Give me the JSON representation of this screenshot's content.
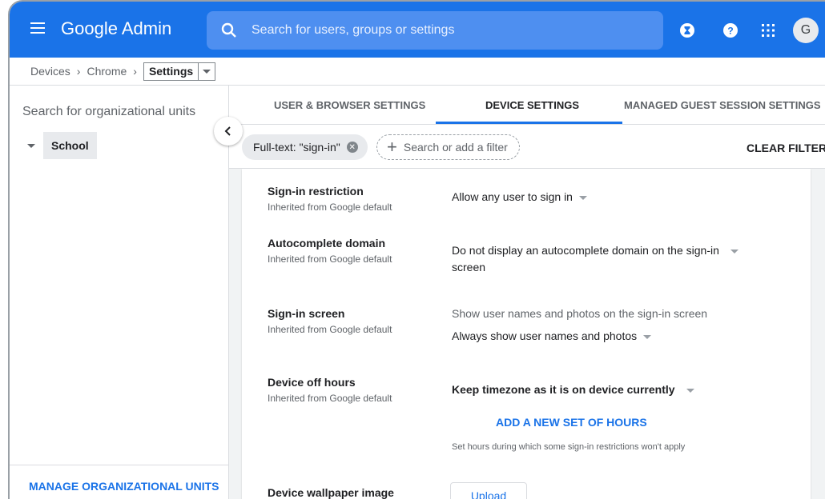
{
  "header": {
    "app_title_google": "Google",
    "app_title_admin": "Admin",
    "search_placeholder": "Search for users, groups or settings",
    "avatar_initial": "G"
  },
  "breadcrumb": {
    "items": [
      "Devices",
      "Chrome"
    ],
    "current": "Settings"
  },
  "sidebar": {
    "search_placeholder": "Search for organizational units",
    "org_unit": "School",
    "manage_label": "MANAGE ORGANIZATIONAL UNITS"
  },
  "tabs": {
    "user_browser": "USER & BROWSER SETTINGS",
    "device": "DEVICE SETTINGS",
    "guest": "MANAGED GUEST SESSION SETTINGS"
  },
  "filters": {
    "chip": "Full-text: \"sign-in\"",
    "add_placeholder": "Search or add a filter",
    "clear": "CLEAR FILTERS"
  },
  "settings": [
    {
      "title": "Sign-in restriction",
      "sub": "Inherited from Google default",
      "value": "Allow any user to sign in"
    },
    {
      "title": "Autocomplete domain",
      "sub": "Inherited from Google default",
      "value_line1": "Do not display an autocomplete domain on the sign-in",
      "value_line2": "screen"
    },
    {
      "title": "Sign-in screen",
      "sub": "Inherited from Google default",
      "hint": "Show user names and photos on the sign-in screen",
      "value": "Always show user names and photos"
    },
    {
      "title": "Device off hours",
      "sub": "Inherited from Google default",
      "value": "Keep timezone as it is on device currently",
      "link": "ADD A NEW SET OF HOURS",
      "hint": "Set hours during which some sign-in restrictions won't apply"
    },
    {
      "title": "Device wallpaper image",
      "button": "Upload"
    }
  ]
}
